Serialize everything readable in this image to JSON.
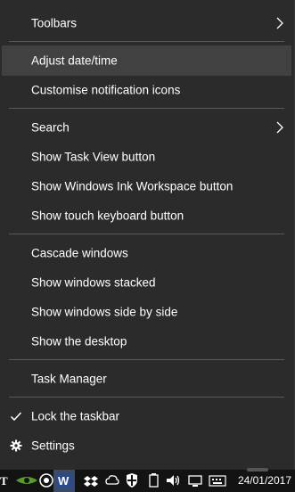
{
  "context_menu": {
    "items": [
      {
        "label": "Toolbars",
        "submenu": true
      },
      {
        "label": "Adjust date/time",
        "highlighted": true
      },
      {
        "label": "Customise notification icons"
      },
      {
        "label": "Search",
        "submenu": true
      },
      {
        "label": "Show Task View button"
      },
      {
        "label": "Show Windows Ink Workspace button"
      },
      {
        "label": "Show touch keyboard button"
      },
      {
        "label": "Cascade windows"
      },
      {
        "label": "Show windows stacked"
      },
      {
        "label": "Show windows side by side"
      },
      {
        "label": "Show the desktop"
      },
      {
        "label": "Task Manager"
      },
      {
        "label": "Lock the taskbar",
        "checked": true
      },
      {
        "label": "Settings",
        "icon": "gear-icon"
      }
    ]
  },
  "taskbar": {
    "clock_date": "24/01/2017",
    "tray_icons": [
      "network-icon",
      "security-icon",
      "battery-icon",
      "volume-icon",
      "keyboard-icon",
      "action-center-icon"
    ]
  },
  "colors": {
    "menu_bg": "#2b2b2b",
    "highlight_bg": "#414141",
    "separator": "#5a5a5a",
    "text": "#ffffff",
    "taskbar_bg": "#131313"
  }
}
